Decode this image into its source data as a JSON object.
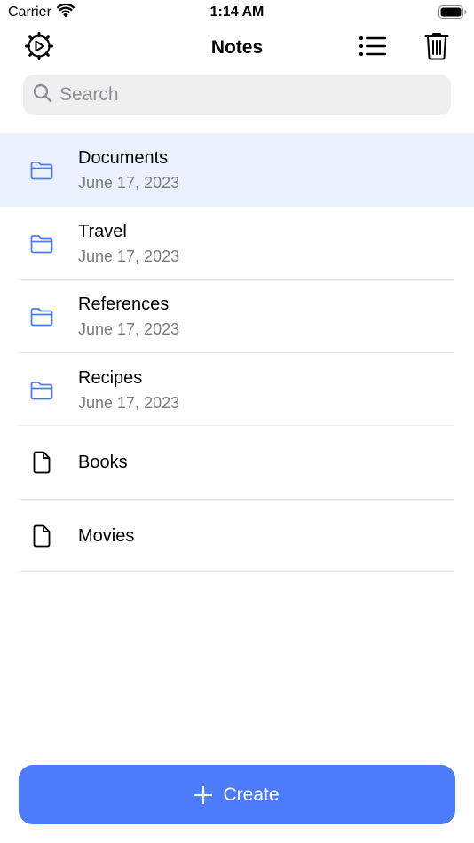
{
  "status_bar": {
    "carrier": "Carrier",
    "time": "1:14 AM"
  },
  "nav": {
    "title": "Notes",
    "left_icon": "settings-gear-icon",
    "right_icons": [
      "list-view-icon",
      "trash-icon"
    ]
  },
  "search": {
    "placeholder": "Search",
    "value": ""
  },
  "items": [
    {
      "type": "folder",
      "icon": "folder-icon",
      "title": "Documents",
      "date": "June 17, 2023",
      "selected": true
    },
    {
      "type": "folder",
      "icon": "folder-icon",
      "title": "Travel",
      "date": "June 17, 2023",
      "selected": false
    },
    {
      "type": "folder",
      "icon": "folder-icon",
      "title": "References",
      "date": "June 17, 2023",
      "selected": false
    },
    {
      "type": "folder",
      "icon": "folder-icon",
      "title": "Recipes",
      "date": "June 17, 2023",
      "selected": false
    },
    {
      "type": "file",
      "icon": "document-icon",
      "title": "Books"
    },
    {
      "type": "file",
      "icon": "document-icon",
      "title": "Movies"
    }
  ],
  "create_button": {
    "label": "Create",
    "icon": "plus-icon"
  },
  "colors": {
    "accent": "#4c7bfc",
    "selected_row": "#ebf1fe",
    "folder_icon": "#4c7bfc",
    "subtitle": "#7a7a80",
    "search_bg": "#efeff0"
  }
}
